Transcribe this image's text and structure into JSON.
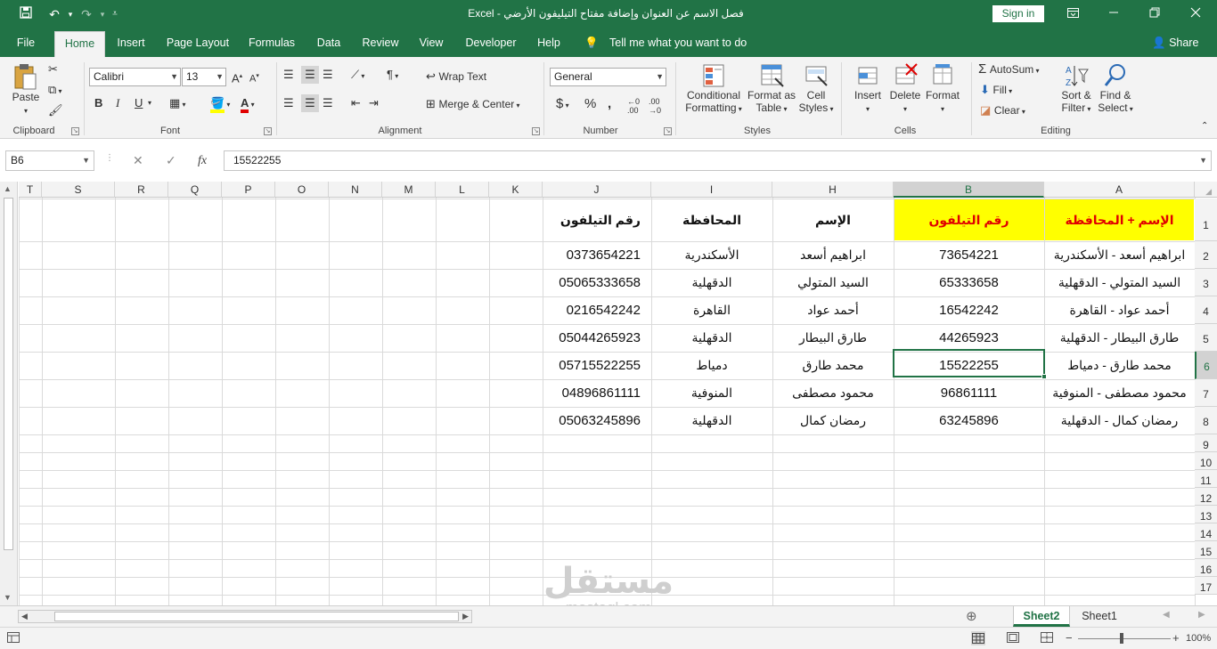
{
  "window": {
    "title": "فصل الاسم عن العنوان وإضافة مفتاح التيليفون الأرضي  -  Excel",
    "sign_in": "Sign in"
  },
  "tabs": [
    "File",
    "Home",
    "Insert",
    "Page Layout",
    "Formulas",
    "Data",
    "Review",
    "View",
    "Developer",
    "Help"
  ],
  "active_tab": "Home",
  "tell_me": "Tell me what you want to do",
  "share": "Share",
  "ribbon": {
    "clipboard": {
      "label": "Clipboard",
      "paste": "Paste"
    },
    "font": {
      "label": "Font",
      "name": "Calibri",
      "size": "13",
      "bold": "B",
      "italic": "I",
      "underline": "U"
    },
    "alignment": {
      "label": "Alignment",
      "wrap_text": "Wrap Text",
      "merge_center": "Merge & Center"
    },
    "number": {
      "label": "Number",
      "format": "General",
      "currency": "$",
      "percent": "%",
      "comma": ","
    },
    "styles": {
      "label": "Styles",
      "conditional_1": "Conditional",
      "conditional_2": "Formatting",
      "format_table_1": "Format as",
      "format_table_2": "Table",
      "cell_styles_1": "Cell",
      "cell_styles_2": "Styles"
    },
    "cells": {
      "label": "Cells",
      "insert": "Insert",
      "delete": "Delete",
      "format": "Format"
    },
    "editing": {
      "label": "Editing",
      "autosum": "AutoSum",
      "fill": "Fill",
      "clear": "Clear",
      "sort_1": "Sort &",
      "sort_2": "Filter",
      "find_1": "Find &",
      "find_2": "Select"
    }
  },
  "formula_bar": {
    "name_box": "B6",
    "fx": "fx",
    "value": "15522255"
  },
  "columns": [
    "T",
    "S",
    "R",
    "Q",
    "P",
    "O",
    "N",
    "M",
    "L",
    "K",
    "J",
    "I",
    "H",
    "B",
    "A"
  ],
  "rows": [
    "1",
    "2",
    "3",
    "4",
    "5",
    "6",
    "7",
    "8",
    "9",
    "10",
    "11",
    "12",
    "13",
    "14",
    "15",
    "16",
    "17"
  ],
  "table": {
    "header": {
      "A": "الإسم + المحافظة",
      "B": "رقم التيلفون",
      "H": "الإسم",
      "I": "المحافظة",
      "J": "رقم التيلفون"
    },
    "rows": [
      {
        "A": "ابراهيم أسعد - الأسكندرية",
        "B": "73654221",
        "H": "ابراهيم أسعد",
        "I": "الأسكندرية",
        "J": "0373654221"
      },
      {
        "A": "السيد المتولي - الدقهلية",
        "B": "65333658",
        "H": "السيد المتولي",
        "I": "الدقهلية",
        "J": "05065333658"
      },
      {
        "A": "أحمد عواد - القاهرة",
        "B": "16542242",
        "H": "أحمد عواد",
        "I": "القاهرة",
        "J": "0216542242"
      },
      {
        "A": "طارق البيطار - الدقهلية",
        "B": "44265923",
        "H": "طارق البيطار",
        "I": "الدقهلية",
        "J": "05044265923"
      },
      {
        "A": "محمد طارق - دمياط",
        "B": "15522255",
        "H": "محمد طارق",
        "I": "دمياط",
        "J": "05715522255"
      },
      {
        "A": "محمود مصطفى - المنوفية",
        "B": "96861111",
        "H": "محمود مصطفى",
        "I": "المنوفية",
        "J": "04896861111"
      },
      {
        "A": "رمضان كمال - الدقهلية",
        "B": "63245896",
        "H": "رمضان كمال",
        "I": "الدقهلية",
        "J": "05063245896"
      }
    ]
  },
  "sheets": [
    "Sheet2",
    "Sheet1"
  ],
  "active_sheet": "Sheet2",
  "status": {
    "zoom": "100%"
  },
  "watermark": {
    "arabic": "مستقل",
    "latin": "mostaql.com"
  },
  "colors": {
    "excel_green": "#217346",
    "header_fill": "#ffff00",
    "header_text": "#e00000"
  }
}
